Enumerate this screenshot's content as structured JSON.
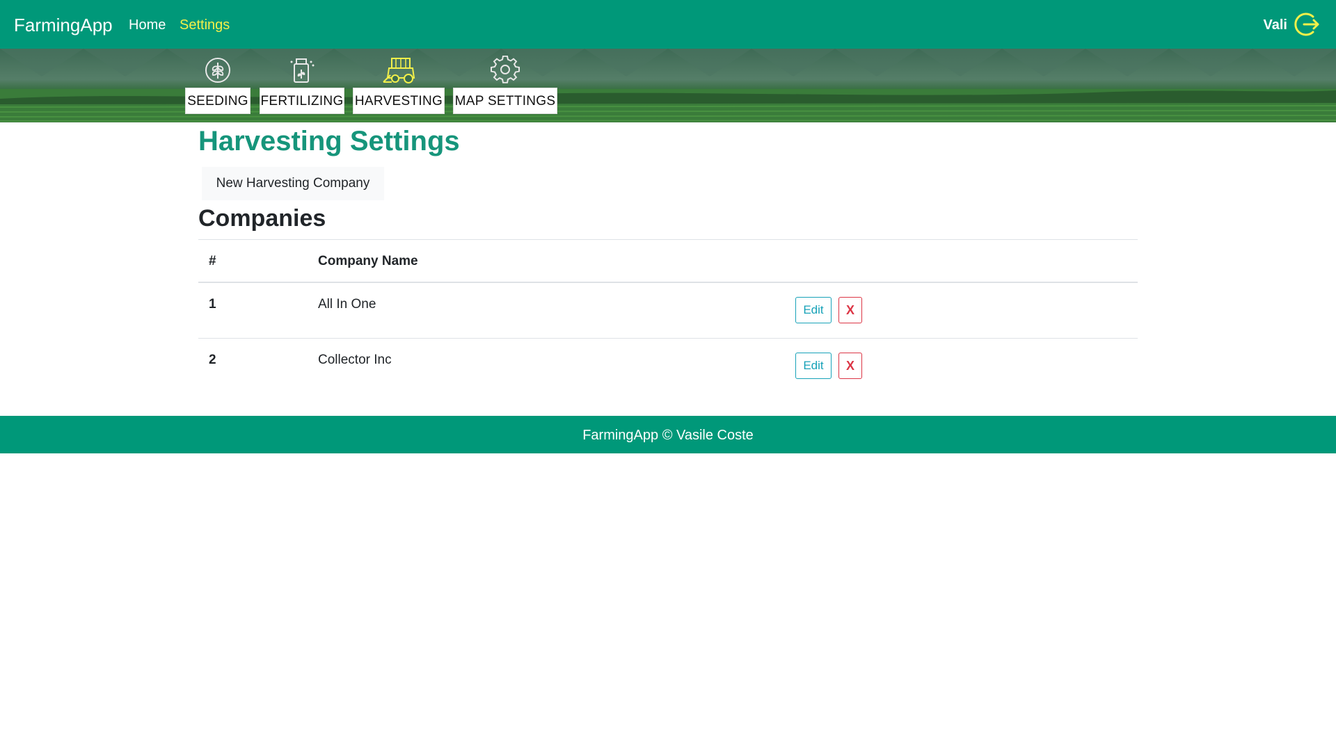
{
  "navbar": {
    "brand": "FarmingApp",
    "links": [
      {
        "label": "Home"
      },
      {
        "label": "Settings",
        "active": true
      }
    ],
    "user": "Vali",
    "logout_icon": "logout-icon",
    "bg_color": "#009879",
    "active_link_color": "#f3f04a"
  },
  "banner": {
    "categories": [
      {
        "label": "SEEDING",
        "icon": "seeding-icon"
      },
      {
        "label": "FERTILIZING",
        "icon": "fertilizing-icon"
      },
      {
        "label": "HARVESTING",
        "icon": "harvesting-icon",
        "active": true
      },
      {
        "label": "MAP SETTINGS",
        "icon": "gear-icon"
      }
    ]
  },
  "main": {
    "title": "Harvesting Settings",
    "new_button": "New Harvesting Company",
    "section_title": "Companies",
    "table": {
      "headers": [
        "#",
        "Company Name"
      ],
      "rows": [
        {
          "num": "1",
          "name": "All In One",
          "edit": "Edit",
          "delete": "X"
        },
        {
          "num": "2",
          "name": "Collector Inc",
          "edit": "Edit",
          "delete": "X"
        }
      ]
    }
  },
  "footer": {
    "text": "FarmingApp © Vasile Coste"
  }
}
